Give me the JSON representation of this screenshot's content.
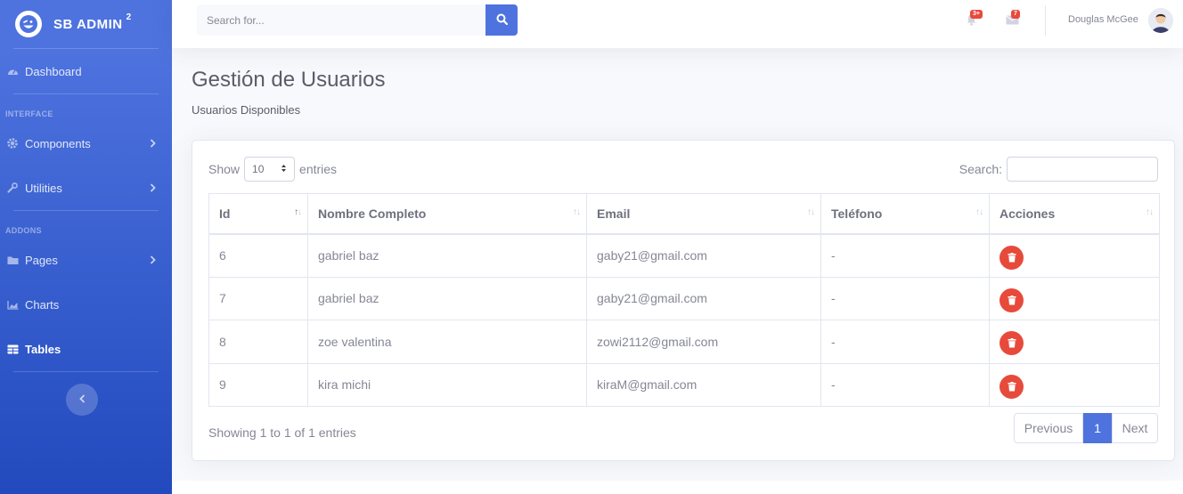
{
  "brand": {
    "name": "SB ADMIN",
    "sup": "2"
  },
  "sidebar": {
    "dashboard": "Dashboard",
    "heading_interface": "INTERFACE",
    "components": "Components",
    "utilities": "Utilities",
    "heading_addons": "ADDONS",
    "pages": "Pages",
    "charts": "Charts",
    "tables": "Tables"
  },
  "topbar": {
    "search_placeholder": "Search for...",
    "alerts_badge": "3+",
    "messages_badge": "7",
    "user_name": "Douglas McGee"
  },
  "page": {
    "title": "Gestión de Usuarios",
    "subtitle": "Usuarios Disponibles"
  },
  "datatable": {
    "show_label": "Show",
    "length_value": "10",
    "entries_label": "entries",
    "search_label": "Search:",
    "columns": [
      "Id",
      "Nombre Completo",
      "Email",
      "Teléfono",
      "Acciones"
    ],
    "rows": [
      {
        "id": "6",
        "name": "gabriel baz",
        "email": "gaby21@gmail.com",
        "phone": "-"
      },
      {
        "id": "7",
        "name": "gabriel baz",
        "email": "gaby21@gmail.com",
        "phone": "-"
      },
      {
        "id": "8",
        "name": "zoe valentina",
        "email": "zowi2112@gmail.com",
        "phone": "-"
      },
      {
        "id": "9",
        "name": "kira michi",
        "email": "kiraM@gmail.com",
        "phone": "-"
      }
    ],
    "info": "Showing 1 to 1 of 1 entries",
    "previous": "Previous",
    "current_page": "1",
    "next": "Next"
  },
  "colors": {
    "primary": "#4e73df",
    "danger": "#e74a3b",
    "sidebar_end": "#224abe"
  }
}
